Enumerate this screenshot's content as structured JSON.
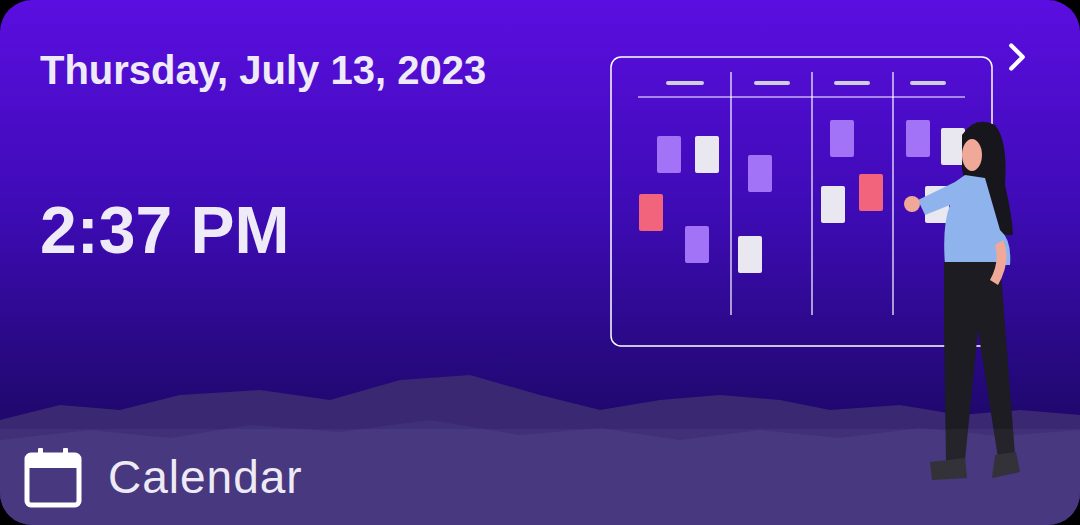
{
  "card": {
    "date": "Thursday, July 13, 2023",
    "time": "2:37 PM",
    "app_label": "Calendar"
  }
}
